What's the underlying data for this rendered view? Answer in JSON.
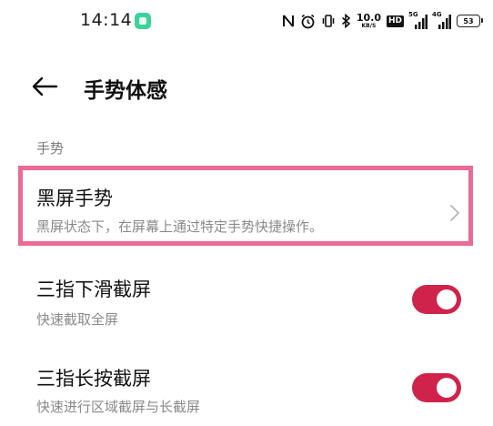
{
  "status_bar": {
    "time": "14:14",
    "net_speed_value": "10.0",
    "net_speed_unit": "KB/S",
    "hd_badge": "HD",
    "signal1_label": "5G",
    "signal2_label": "4G",
    "battery_level": "53",
    "icons": [
      "nfc-icon",
      "alarm-icon",
      "vibrate-icon",
      "bluetooth-icon"
    ]
  },
  "header": {
    "title": "手势体感"
  },
  "section": {
    "label": "手势"
  },
  "items": [
    {
      "title": "黑屏手势",
      "subtitle": "黑屏状态下，在屏幕上通过特定手势快捷操作。",
      "control": "chevron"
    },
    {
      "title": "三指下滑截屏",
      "subtitle": "快速截取全屏",
      "control": "toggle",
      "enabled": true
    },
    {
      "title": "三指长按截屏",
      "subtitle": "快速进行区域截屏与长截屏",
      "control": "toggle",
      "enabled": true
    }
  ],
  "colors": {
    "toggle_on": "#d0234b",
    "highlight_border": "#ec6a93",
    "app_icon": "#3bd29b"
  }
}
